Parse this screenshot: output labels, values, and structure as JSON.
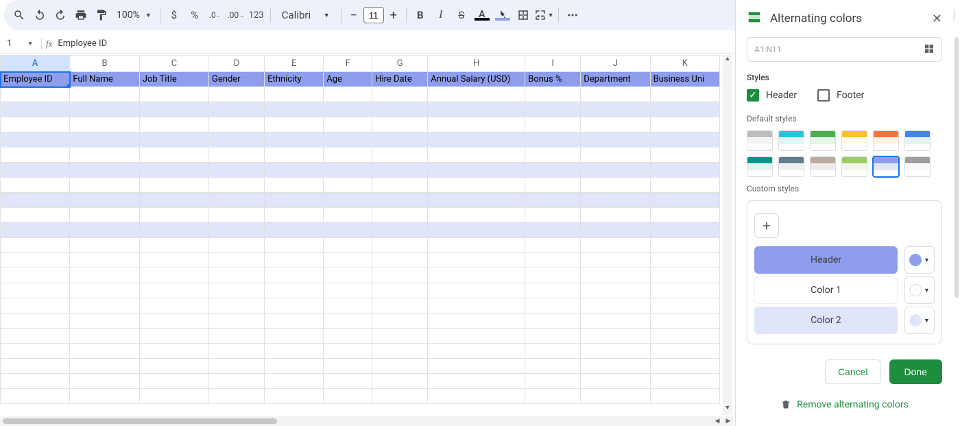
{
  "toolbar": {
    "zoom": "100%",
    "fontName": "Calibri",
    "fontSize": "11"
  },
  "nameBox": "1",
  "formulaBar": "Employee ID",
  "columns": [
    "A",
    "B",
    "C",
    "D",
    "E",
    "F",
    "G",
    "H",
    "I",
    "J",
    "K"
  ],
  "headerRow": [
    "Employee ID",
    "Full Name",
    "Job Title",
    "Gender",
    "Ethnicity",
    "Age",
    "Hire Date",
    "Annual Salary (USD)",
    "Bonus %",
    "Department",
    "Business Uni"
  ],
  "sidebar": {
    "title": "Alternating colors",
    "rangeHint": "A1:N11",
    "stylesLabel": "Styles",
    "headerCheck": "Header",
    "footerCheck": "Footer",
    "defaultStylesLabel": "Default styles",
    "customStylesLabel": "Custom styles",
    "rows": {
      "header": "Header",
      "color1": "Color 1",
      "color2": "Color 2"
    },
    "colors": {
      "header": "#8e9eec",
      "color1": "#ffffff",
      "color2": "#e0e5f9"
    },
    "cancel": "Cancel",
    "done": "Done",
    "remove": "Remove alternating colors"
  },
  "defaultStyles": [
    {
      "h": "#bdbdbd",
      "a": "#f5f5f5",
      "b": "#ffffff"
    },
    {
      "h": "#26c6da",
      "a": "#e0f7fa",
      "b": "#ffffff"
    },
    {
      "h": "#4caf50",
      "a": "#e8f5e9",
      "b": "#ffffff"
    },
    {
      "h": "#fbc02d",
      "a": "#fffde7",
      "b": "#ffffff"
    },
    {
      "h": "#ff7043",
      "a": "#fff3e0",
      "b": "#ffffff"
    },
    {
      "h": "#4285f4",
      "a": "#e8f0fe",
      "b": "#ffffff"
    },
    {
      "h": "#009688",
      "a": "#e0f2f1",
      "b": "#ffffff"
    },
    {
      "h": "#607d8b",
      "a": "#eceff1",
      "b": "#ffffff"
    },
    {
      "h": "#bcaaa4",
      "a": "#efebe9",
      "b": "#ffffff"
    },
    {
      "h": "#9ccc65",
      "a": "#f1f8e9",
      "b": "#ffffff"
    },
    {
      "h": "#8e9eec",
      "a": "#e0e5f9",
      "b": "#ffffff"
    },
    {
      "h": "#9e9e9e",
      "a": "#fafafa",
      "b": "#ffffff"
    }
  ]
}
